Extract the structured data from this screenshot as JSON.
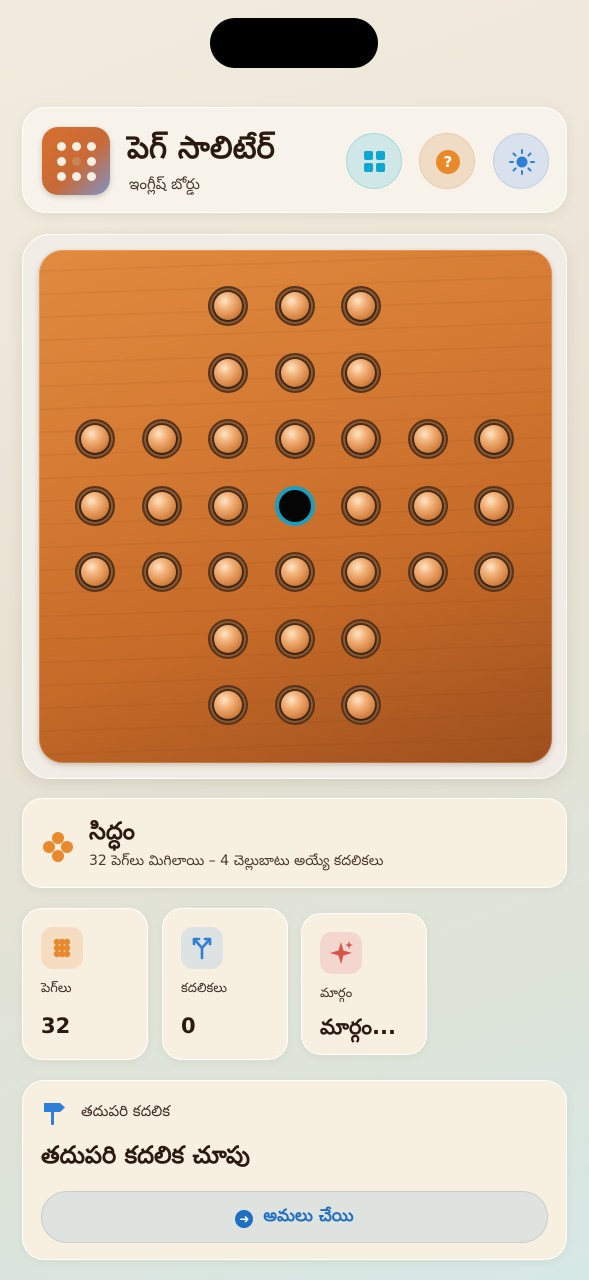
{
  "header": {
    "title": "పెగ్ సాలిటేర్",
    "subtitle": "ఇంగ్లీష్ బోర్డు",
    "buttons": {
      "boards": {
        "icon": "grid-icon",
        "color": "#10a6d2"
      },
      "help": {
        "icon": "question-icon",
        "glyph": "?",
        "color": "#e88a2a"
      },
      "theme": {
        "icon": "sun-icon",
        "color": "#2f7fd8"
      }
    }
  },
  "board": {
    "layout": [
      "..XXX..",
      "..XXX..",
      "XXXXXXX",
      "XXXOXXX",
      "XXXXXXX",
      "..XXX..",
      "..XXX.."
    ],
    "peg_color": "#d88645",
    "empty_ring_color": "#1aa0bf"
  },
  "status": {
    "title": "సిద్ధం",
    "subtitle": "32 పెగ్‌లు మిగిలాయి – 4 చెల్లుబాటు అయ్యే కదలికలు",
    "icon": "pegs-icon"
  },
  "stats": [
    {
      "label": "పెగ్‌లు",
      "value": "32",
      "icon": "pegs-icon",
      "badge_color": "#f6dcc0"
    },
    {
      "label": "కదలికలు",
      "value": "0",
      "icon": "fork-icon",
      "badge_color": "#dde3e3"
    },
    {
      "label": "మార్గం",
      "value": "మార్గం...",
      "icon": "sparkle-icon",
      "badge_color": "#f3d6cd"
    }
  ],
  "next_move": {
    "label": "తదుపరి కదలిక",
    "title": "తదుపరి కదలిక చూపు",
    "button_label": "అమలు చేయి",
    "button_glyph": "➜",
    "icon": "signpost-icon"
  }
}
